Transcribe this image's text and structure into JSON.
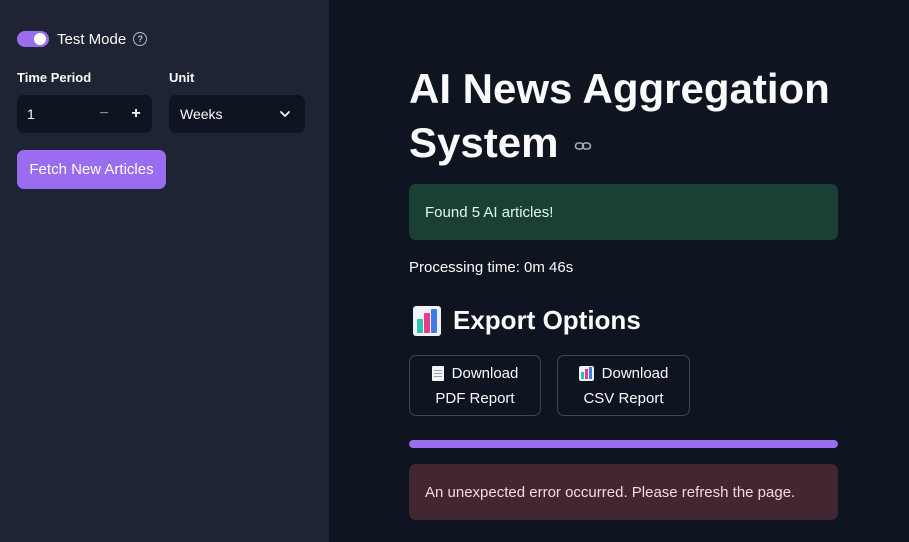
{
  "sidebar": {
    "test_mode": {
      "label": "Test Mode",
      "enabled": true,
      "help": "?"
    },
    "time_period": {
      "label": "Time Period",
      "value": "1",
      "minus": "−",
      "plus": "+"
    },
    "unit": {
      "label": "Unit",
      "selected": "Weeks"
    },
    "fetch_button": "Fetch New Articles"
  },
  "main": {
    "title": "AI News Aggregation System",
    "success_message": "Found 5 AI articles!",
    "processing_time": "Processing time: 0m 46s",
    "export_heading": "Export Options",
    "download_pdf": {
      "line1": "Download",
      "line2": "PDF Report"
    },
    "download_csv": {
      "line1": "Download",
      "line2": "CSV Report"
    },
    "progress": 1.0,
    "error_message": "An unexpected error occurred. Please refresh the page."
  },
  "colors": {
    "accent": "#9a6cf0",
    "success_bg": "#1a4034",
    "error_bg": "#43262f",
    "sidebar_bg": "#1e2433",
    "main_bg": "#0f1520"
  },
  "icons": [
    "help-icon",
    "chevron-down-icon",
    "link-icon",
    "bar-chart-icon",
    "document-icon"
  ]
}
